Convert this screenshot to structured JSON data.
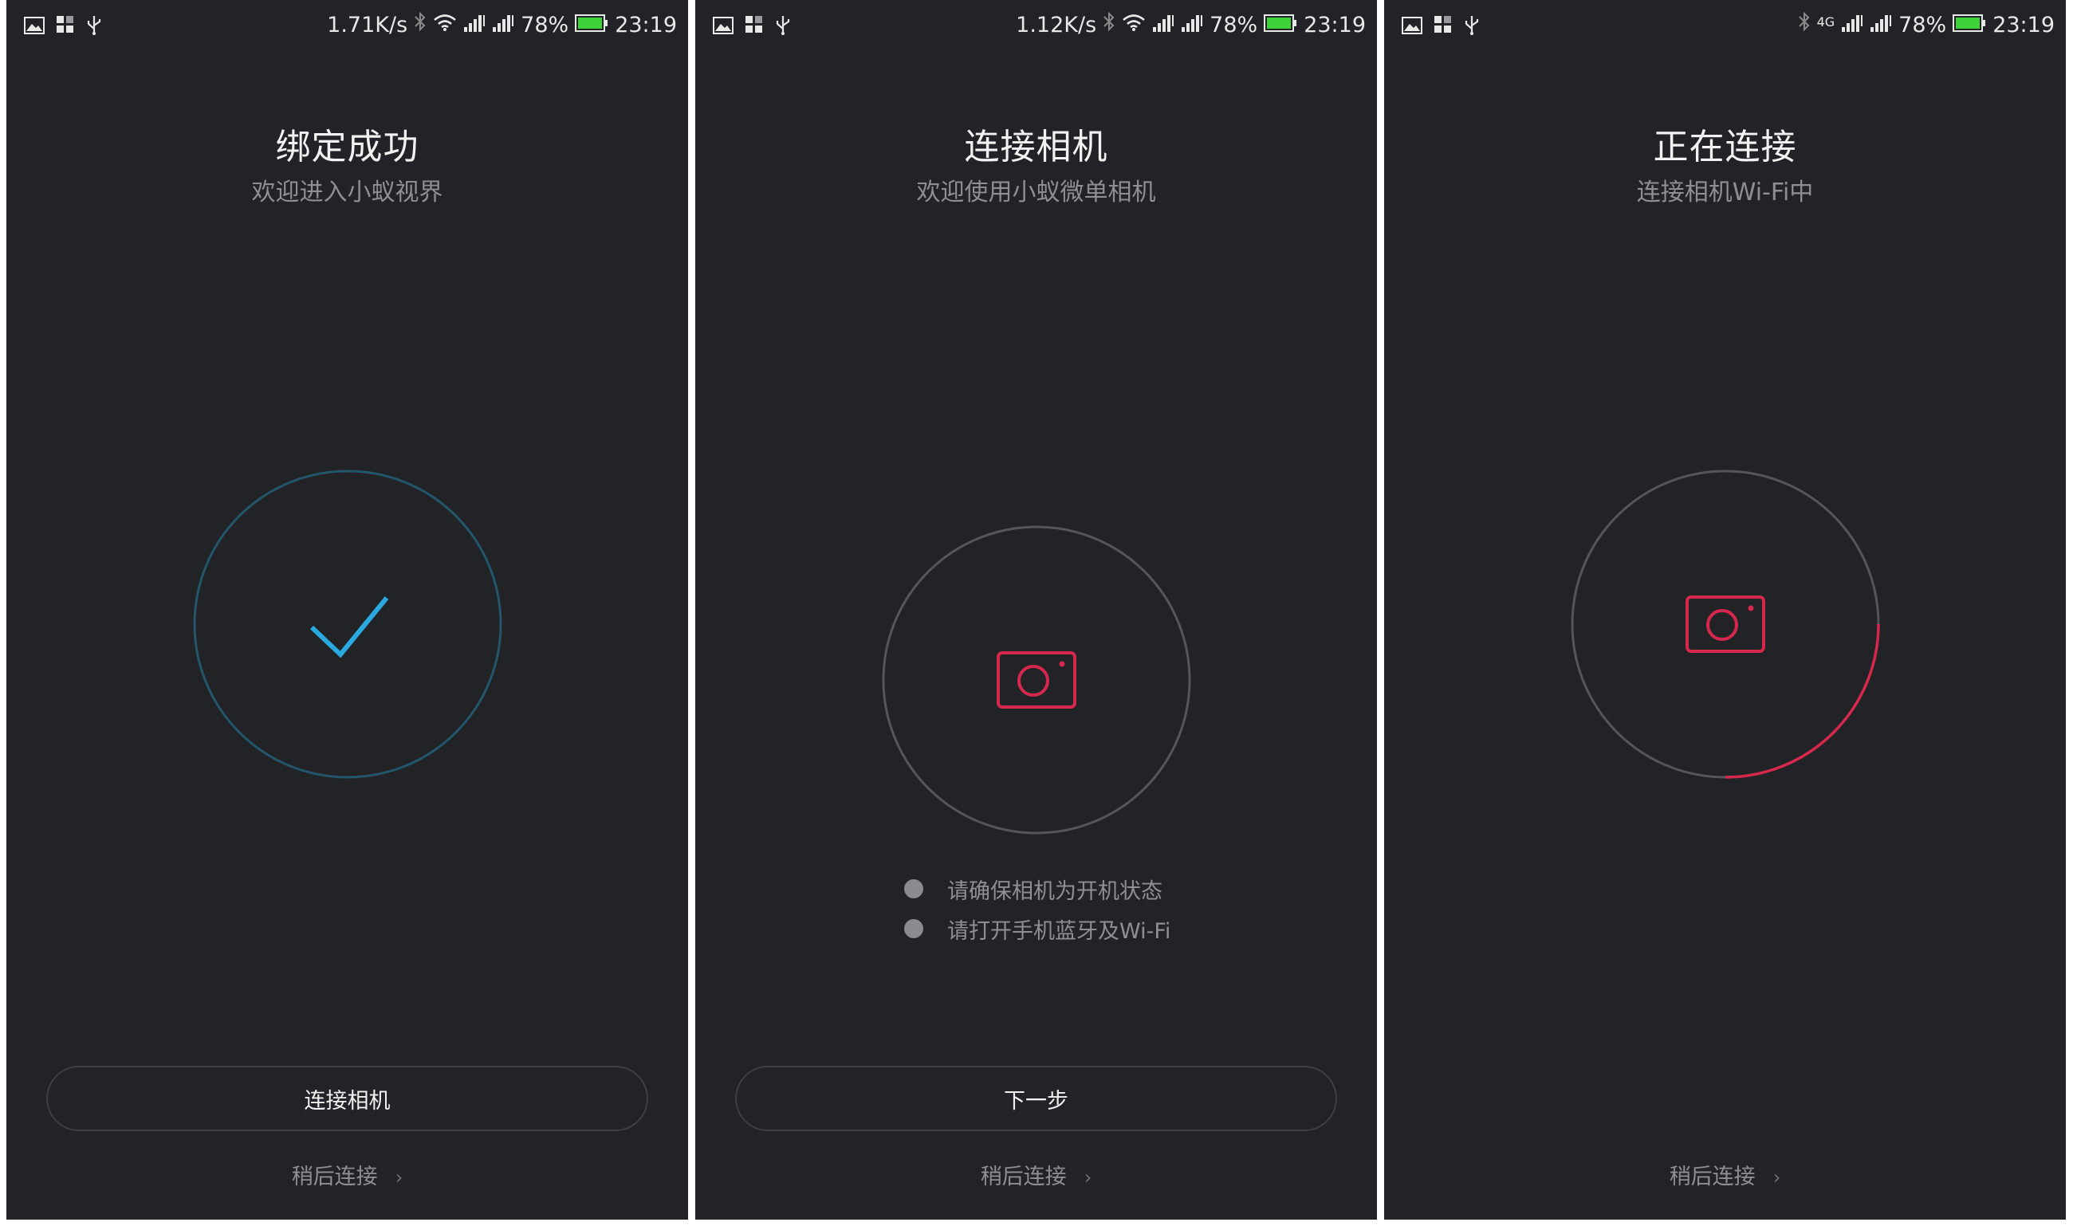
{
  "colors": {
    "background": "#222327",
    "accent_blue": "#2aa8e0",
    "accent_red": "#d6284c",
    "ring_gray": "#55565b",
    "ring_teal": "#23566a"
  },
  "panels": [
    {
      "status": {
        "net_speed": "1.71K/s",
        "battery": "78%",
        "time": "23:19",
        "left_icons": [
          "image-icon",
          "grid-icon",
          "usb-icon"
        ],
        "right_icons": [
          "bluetooth-icon",
          "wifi-icon",
          "signal-icon",
          "signal-icon",
          "battery-icon"
        ]
      },
      "title": "绑定成功",
      "subtitle": "欢迎进入小蚁视界",
      "center_icon": "checkmark-icon",
      "button_label": "连接相机",
      "later_label": "稍后连接"
    },
    {
      "status": {
        "net_speed": "1.12K/s",
        "battery": "78%",
        "time": "23:19",
        "left_icons": [
          "image-icon",
          "grid-icon",
          "usb-icon"
        ],
        "right_icons": [
          "bluetooth-icon",
          "wifi-icon",
          "signal-icon",
          "signal-icon",
          "battery-icon"
        ]
      },
      "title": "连接相机",
      "subtitle": "欢迎使用小蚁微单相机",
      "center_icon": "camera-icon",
      "instructions": [
        "请确保相机为开机状态",
        "请打开手机蓝牙及Wi-Fi"
      ],
      "button_label": "下一步",
      "later_label": "稍后连接"
    },
    {
      "status": {
        "net_label": "4G",
        "battery": "78%",
        "time": "23:19",
        "left_icons": [
          "image-icon",
          "grid-icon",
          "usb-icon"
        ],
        "right_icons": [
          "bluetooth-icon",
          "signal-icon",
          "signal-icon",
          "battery-icon"
        ]
      },
      "title": "正在连接",
      "subtitle": "连接相机Wi-Fi中",
      "center_icon": "camera-icon",
      "connecting_progress": 0.25,
      "later_label": "稍后连接"
    }
  ]
}
